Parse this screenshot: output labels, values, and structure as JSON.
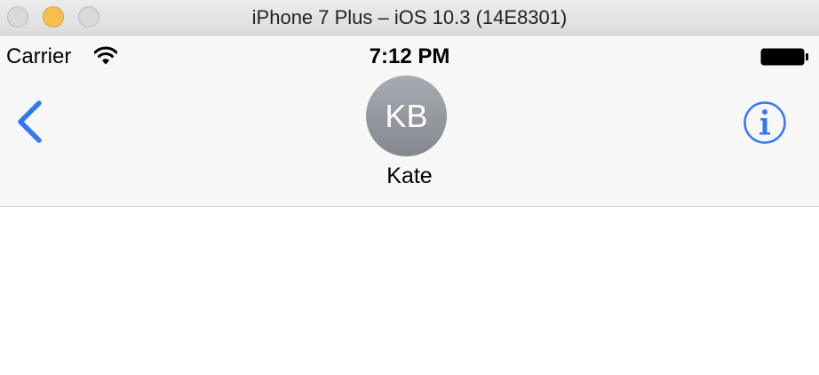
{
  "window": {
    "title": "iPhone 7 Plus – iOS 10.3 (14E8301)"
  },
  "status_bar": {
    "carrier": "Carrier",
    "time": "7:12 PM",
    "icons": [
      "wifi-icon",
      "battery-icon"
    ]
  },
  "nav_bar": {
    "avatar_initials": "KB",
    "contact_name": "Kate",
    "back_icon": "chevron-left-icon",
    "info_icon": "info-icon"
  },
  "colors": {
    "accent": "#3478f6",
    "avatar_top": "#a9abb2",
    "avatar_bottom": "#85878f",
    "navbar_bg": "#f7f7f7",
    "minimize_light": "#f6be4f"
  }
}
